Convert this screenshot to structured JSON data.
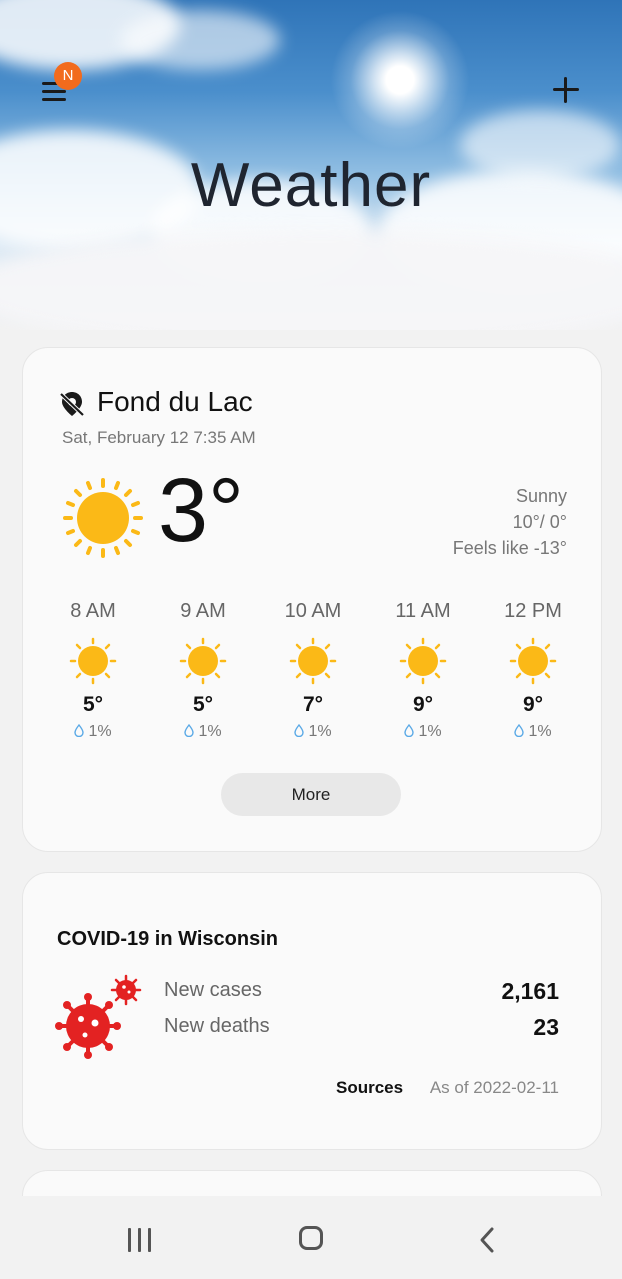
{
  "header": {
    "title": "Weather",
    "menu_badge": "N"
  },
  "weather": {
    "location": "Fond du Lac",
    "datetime": "Sat, February 12 7:35 AM",
    "temperature": "3°",
    "condition": "Sunny",
    "high_low": "10°/ 0°",
    "feels_like": "Feels like -13°",
    "hourly": [
      {
        "time": "8 AM",
        "temp": "5°",
        "precip": "1%",
        "icon": "sun-icon"
      },
      {
        "time": "9 AM",
        "temp": "5°",
        "precip": "1%",
        "icon": "sun-icon"
      },
      {
        "time": "10 AM",
        "temp": "7°",
        "precip": "1%",
        "icon": "sun-icon"
      },
      {
        "time": "11 AM",
        "temp": "9°",
        "precip": "1%",
        "icon": "sun-icon"
      },
      {
        "time": "12 PM",
        "temp": "9°",
        "precip": "1%",
        "icon": "sun-icon"
      }
    ],
    "more_label": "More"
  },
  "covid": {
    "title": "COVID-19 in Wisconsin",
    "new_cases_label": "New cases",
    "new_cases_value": "2,161",
    "new_deaths_label": "New deaths",
    "new_deaths_value": "23",
    "sources_label": "Sources",
    "as_of": "As of 2022-02-11"
  },
  "colors": {
    "sun": "#fbb917",
    "virus": "#e32222",
    "badge": "#f26b1d",
    "drop": "#5aa9e6"
  },
  "icons": [
    "menu-icon",
    "add-icon",
    "location-off-icon",
    "sun-icon",
    "water-drop-icon",
    "virus-icon",
    "recent-apps-icon",
    "home-icon",
    "back-icon"
  ]
}
